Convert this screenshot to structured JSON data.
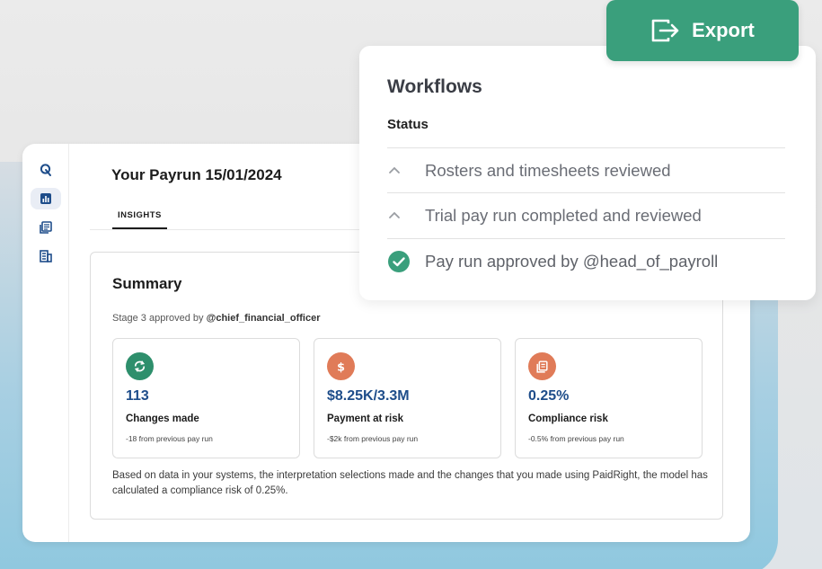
{
  "app": {
    "page_title": "Your Payrun 15/01/2024",
    "tabs": [
      {
        "label": "INSIGHTS",
        "active": true
      }
    ]
  },
  "sidebar": {
    "items": [
      {
        "icon": "logo-icon",
        "active": false
      },
      {
        "icon": "bar-chart-icon",
        "active": true
      },
      {
        "icon": "documents-icon",
        "active": false
      },
      {
        "icon": "building-icon",
        "active": false
      }
    ]
  },
  "summary": {
    "title": "Summary",
    "stage_prefix": "Stage 3 approved by",
    "stage_user": "@chief_financial_officer",
    "metrics": [
      {
        "icon": "refresh-icon",
        "icon_color": "#2e8f6c",
        "value": "113",
        "label": "Changes made",
        "sub": "-18 from previous pay run"
      },
      {
        "icon": "dollar-icon",
        "icon_color": "#e07b58",
        "value": "$8.25K/3.3M",
        "label": "Payment at risk",
        "sub": "-$2k from previous pay run"
      },
      {
        "icon": "documents-icon",
        "icon_color": "#e07b58",
        "value": "0.25%",
        "label": "Compliance risk",
        "sub": "-0.5% from previous pay run"
      }
    ],
    "note": "Based on data in your systems, the interpretation selections made and the changes that you made using PaidRight, the model has calculated a compliance risk of 0.25%."
  },
  "workflows": {
    "title": "Workflows",
    "status_label": "Status",
    "items": [
      {
        "label": "Rosters and timesheets reviewed",
        "state": "pending",
        "icon": "chevron-up-icon"
      },
      {
        "label": "Trial pay run completed and reviewed",
        "state": "pending",
        "icon": "chevron-up-icon"
      },
      {
        "label": "Pay run approved by @head_of_payroll",
        "state": "done",
        "icon": "check-circle-icon"
      }
    ]
  },
  "export": {
    "label": "Export",
    "icon": "export-icon",
    "color": "#3a9f7c"
  },
  "colors": {
    "accent_green": "#3a9f7c",
    "value_blue": "#1e4d8a",
    "orange": "#e07b58"
  }
}
